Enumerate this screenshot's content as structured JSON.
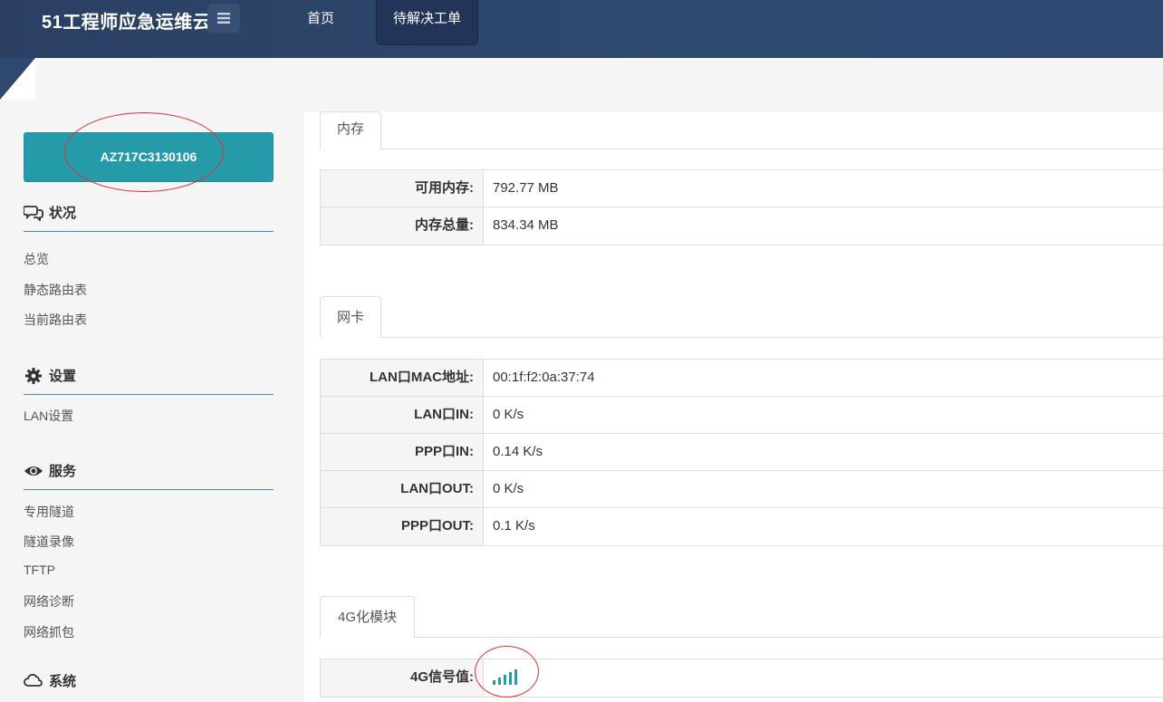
{
  "header": {
    "brand": "51工程师应急运维云",
    "nav": [
      {
        "label": "首页"
      },
      {
        "label": "待解决工单",
        "active": true
      }
    ]
  },
  "sidebar": {
    "device_id": "AZ717C3130106",
    "sections": [
      {
        "title": "状况",
        "icon": "comments-icon",
        "items": [
          "总览",
          "静态路由表",
          "当前路由表"
        ]
      },
      {
        "title": "设置",
        "icon": "gear-icon",
        "items": [
          "LAN设置"
        ]
      },
      {
        "title": "服务",
        "icon": "eye-icon",
        "items": [
          "专用隧道",
          "隧道录像",
          "TFTP",
          "网络诊断",
          "网络抓包"
        ]
      },
      {
        "title": "系统",
        "icon": "cloud-icon",
        "items": []
      }
    ]
  },
  "main": {
    "memory": {
      "tab": "内存",
      "rows": [
        {
          "key": "可用内存:",
          "value": "792.77 MB"
        },
        {
          "key": "内存总量:",
          "value": "834.34 MB"
        }
      ]
    },
    "nic": {
      "tab": "网卡",
      "rows": [
        {
          "key": "LAN口MAC地址:",
          "value": "00:1f:f2:0a:37:74"
        },
        {
          "key": "LAN口IN:",
          "value": "0 K/s"
        },
        {
          "key": "PPP口IN:",
          "value": "0.14 K/s"
        },
        {
          "key": "LAN口OUT:",
          "value": "0 K/s"
        },
        {
          "key": "PPP口OUT:",
          "value": "0.1 K/s"
        }
      ]
    },
    "module4g": {
      "tab": "4G化模块",
      "rows": [
        {
          "key": "4G信号值:",
          "signal_bars": 5,
          "signal_icon": "signal-bars-icon"
        }
      ]
    }
  },
  "colors": {
    "header_bg": "#2e4870",
    "accent": "#259ba9",
    "annotation": "#e0302a",
    "divider": "#3d8fc3"
  }
}
